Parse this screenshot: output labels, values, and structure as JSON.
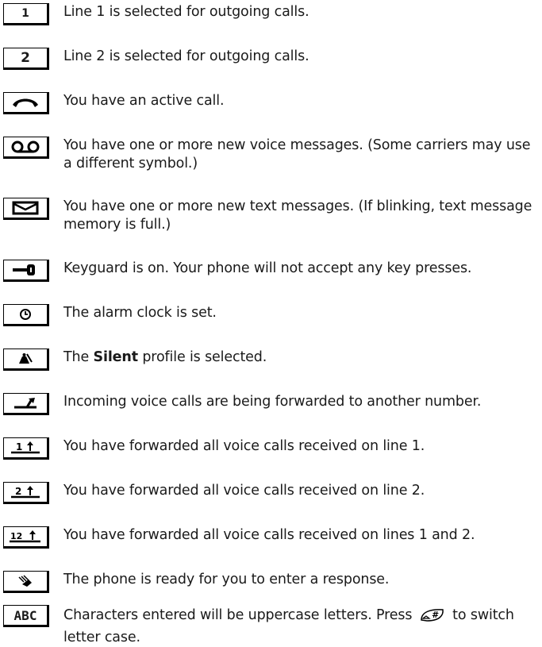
{
  "items": [
    {
      "icon": "line-1-icon",
      "text": "Line 1 is selected for outgoing calls."
    },
    {
      "icon": "line-2-icon",
      "text": "Line 2 is selected for outgoing calls."
    },
    {
      "icon": "active-call-icon",
      "text": "You have an active call."
    },
    {
      "icon": "voice-message-icon",
      "text": "You have one or more new voice messages. (Some carriers may use a different symbol.)"
    },
    {
      "icon": "text-message-icon",
      "text": "You have one or more new text messages. (If blinking, text message memory is full.)"
    },
    {
      "icon": "keyguard-icon",
      "text": "Keyguard is on. Your phone will not accept any key presses."
    },
    {
      "icon": "alarm-clock-icon",
      "text": "The alarm clock is set."
    },
    {
      "icon": "silent-profile-icon",
      "text_before": "The ",
      "text_bold": "Silent",
      "text_after": " profile is selected."
    },
    {
      "icon": "call-forward-icon",
      "text": "Incoming voice calls are being forwarded to another number."
    },
    {
      "icon": "forward-line-1-icon",
      "text": "You have forwarded all voice calls received on line 1."
    },
    {
      "icon": "forward-line-2-icon",
      "text": "You have forwarded all voice calls received on line 2."
    },
    {
      "icon": "forward-lines-1-2-icon",
      "text": "You have forwarded all voice calls received on lines 1 and 2."
    },
    {
      "icon": "response-ready-icon",
      "text": "The phone is ready for you to enter a response."
    },
    {
      "icon": "uppercase-abc-icon",
      "text_before": "Characters entered will be uppercase letters. Press ",
      "key_icon": "hash-key-icon",
      "text_after": " to switch letter case."
    }
  ],
  "icon_labels": {
    "line1": "1",
    "line2": "2",
    "forward1": "1",
    "forward2": "2",
    "forward12": "12",
    "abc": "ABC"
  }
}
